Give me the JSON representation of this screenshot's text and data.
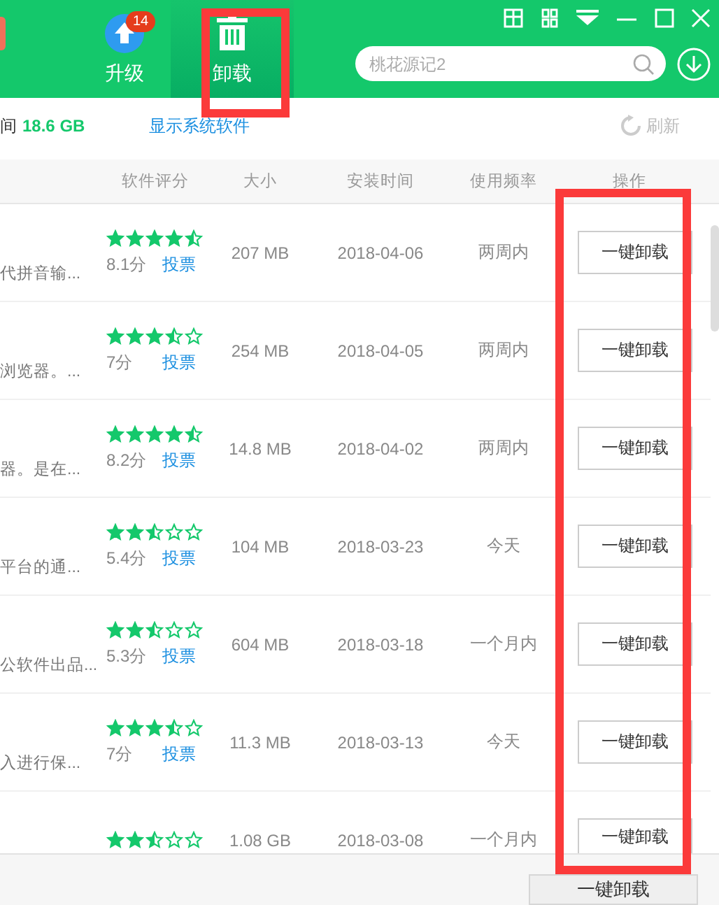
{
  "tabs": [
    {
      "label": "升级",
      "kind": "upgrade",
      "badge": "14",
      "selected": false,
      "highlighted": false
    },
    {
      "label": "卸载",
      "kind": "uninstall",
      "selected": true,
      "highlighted": true
    }
  ],
  "search": {
    "placeholder": "桃花源记2"
  },
  "info_bar": {
    "space_label": "间",
    "space_value": "18.6 GB",
    "system_link": "显示系统软件",
    "refresh": "刷新"
  },
  "table": {
    "columns": [
      "软件评分",
      "大小",
      "安装时间",
      "使用频率",
      "操作"
    ],
    "action_column_highlighted": true,
    "rows": [
      {
        "description": "代拼音输...",
        "stars": 4.5,
        "score": "8.1分",
        "vote": "投票",
        "size": "207 MB",
        "installed": "2018-04-06",
        "frequency": "两周内",
        "action": "一键卸载"
      },
      {
        "description": "浏览器。...",
        "stars": 3.5,
        "score": "7分",
        "vote": "投票",
        "size": "254 MB",
        "installed": "2018-04-05",
        "frequency": "两周内",
        "action": "一键卸载"
      },
      {
        "description": "器。是在...",
        "stars": 4.5,
        "score": "8.2分",
        "vote": "投票",
        "size": "14.8 MB",
        "installed": "2018-04-02",
        "frequency": "两周内",
        "action": "一键卸载"
      },
      {
        "description": "平台的通...",
        "stars": 2.5,
        "score": "5.4分",
        "vote": "投票",
        "size": "104 MB",
        "installed": "2018-03-23",
        "frequency": "今天",
        "action": "一键卸载"
      },
      {
        "description": "公软件出品...",
        "stars": 2.5,
        "score": "5.3分",
        "vote": "投票",
        "size": "604 MB",
        "installed": "2018-03-18",
        "frequency": "一个月内",
        "action": "一键卸载"
      },
      {
        "description": "入进行保...",
        "stars": 3.5,
        "score": "7分",
        "vote": "投票",
        "size": "11.3 MB",
        "installed": "2018-03-13",
        "frequency": "今天",
        "action": "一键卸载"
      },
      {
        "stars": 2.5,
        "size": "1.08 GB",
        "installed": "2018-03-08",
        "frequency": "一个月内",
        "action": "一键卸载"
      }
    ]
  },
  "footer": {
    "button": "一键卸载"
  }
}
